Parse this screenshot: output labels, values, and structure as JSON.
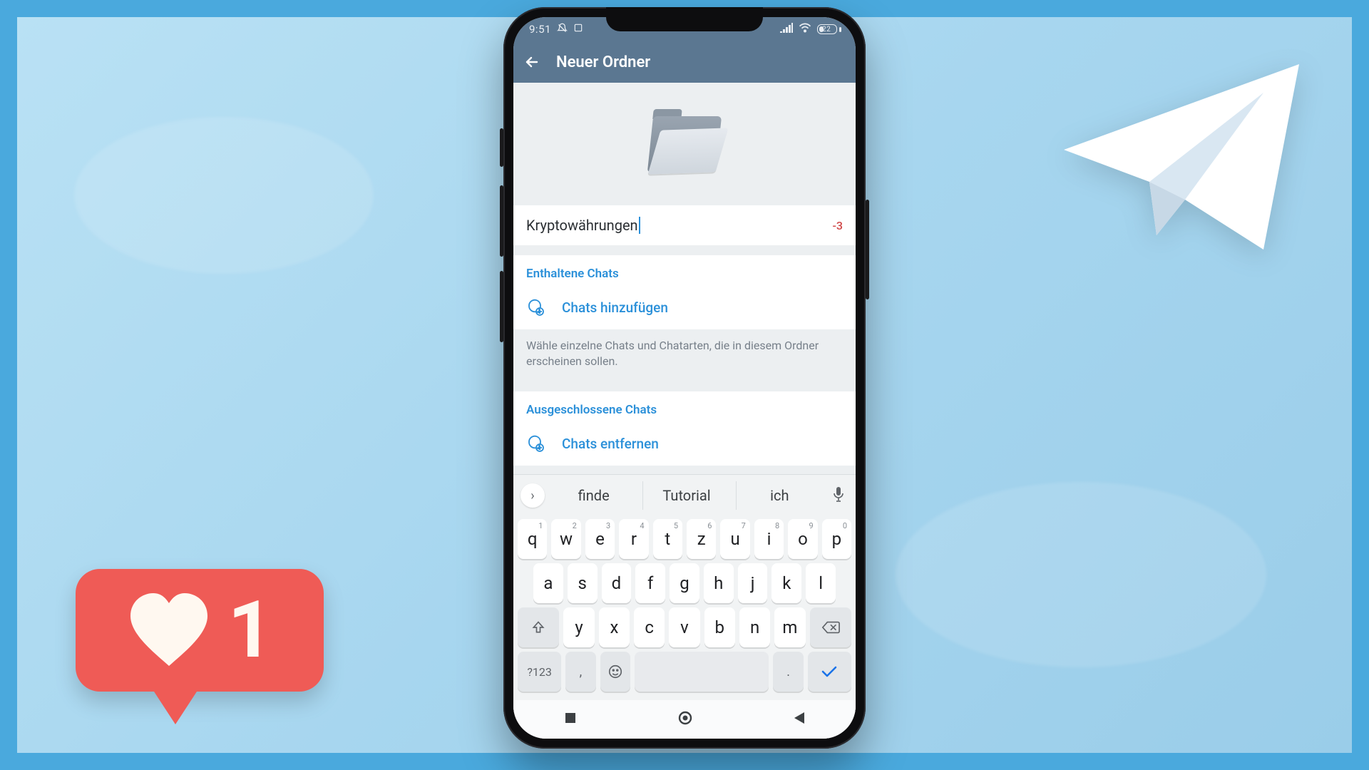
{
  "statusbar": {
    "time": "9:51",
    "battery_pct": "22"
  },
  "appbar": {
    "title": "Neuer Ordner"
  },
  "folder_name": {
    "value": "Kryptowährungen",
    "counter": "-3"
  },
  "included": {
    "title": "Enthaltene Chats",
    "add_label": "Chats hinzufügen",
    "helper": "Wähle einzelne Chats und Chatarten, die in diesem Ordner erscheinen sollen."
  },
  "excluded": {
    "title": "Ausgeschlossene Chats",
    "remove_label": "Chats entfernen"
  },
  "keyboard": {
    "suggestions": [
      "finde",
      "Tutorial",
      "ich"
    ],
    "row1": [
      {
        "k": "q",
        "n": "1"
      },
      {
        "k": "w",
        "n": "2"
      },
      {
        "k": "e",
        "n": "3"
      },
      {
        "k": "r",
        "n": "4"
      },
      {
        "k": "t",
        "n": "5"
      },
      {
        "k": "z",
        "n": "6"
      },
      {
        "k": "u",
        "n": "7"
      },
      {
        "k": "i",
        "n": "8"
      },
      {
        "k": "o",
        "n": "9"
      },
      {
        "k": "p",
        "n": "0"
      }
    ],
    "row2": [
      "a",
      "s",
      "d",
      "f",
      "g",
      "h",
      "j",
      "k",
      "l"
    ],
    "row3": [
      "y",
      "x",
      "c",
      "v",
      "b",
      "n",
      "m"
    ],
    "symbols_label": "?123",
    "comma": ",",
    "period": "."
  },
  "like_sticker": {
    "count": "1"
  }
}
